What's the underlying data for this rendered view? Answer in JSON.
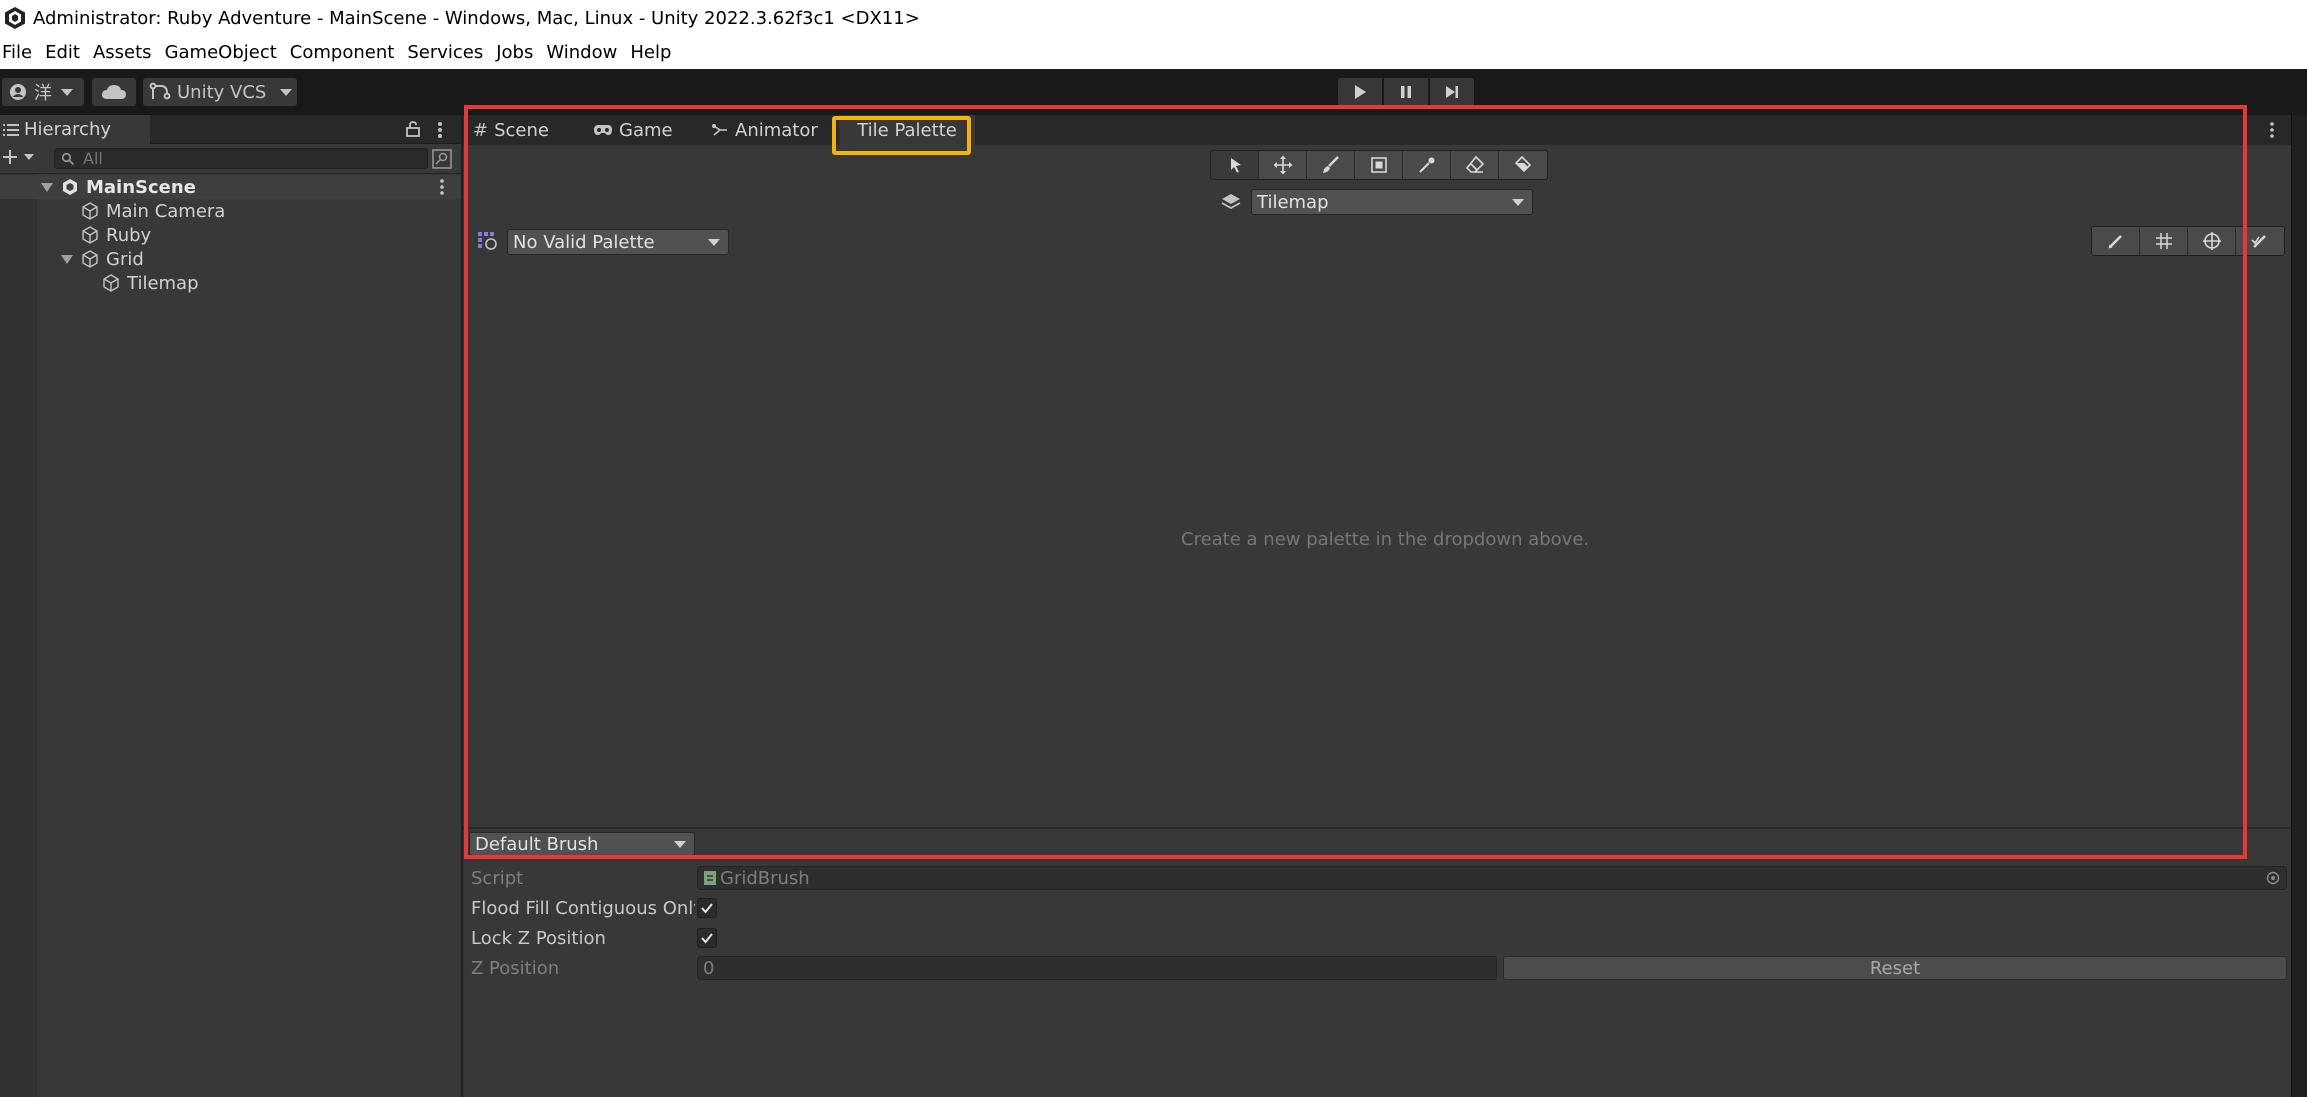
{
  "window": {
    "title": "Administrator: Ruby Adventure - MainScene - Windows, Mac, Linux - Unity 2022.3.62f3c1 <DX11>"
  },
  "menu": [
    "File",
    "Edit",
    "Assets",
    "GameObject",
    "Component",
    "Services",
    "Jobs",
    "Window",
    "Help"
  ],
  "toolbar": {
    "account_label": "洋",
    "vcs_label": "Unity VCS"
  },
  "hierarchy": {
    "tab_label": "Hierarchy",
    "search_placeholder": "All",
    "scene_name": "MainScene",
    "items": [
      {
        "label": "Main Camera"
      },
      {
        "label": "Ruby"
      },
      {
        "label": "Grid"
      },
      {
        "label": "Tilemap"
      }
    ]
  },
  "main": {
    "tabs": [
      {
        "label": "Scene",
        "icon": "grid-hash-icon"
      },
      {
        "label": "Game",
        "icon": "gamepad-icon"
      },
      {
        "label": "Animator",
        "icon": "animator-icon"
      },
      {
        "label": "Tile Palette",
        "icon": "",
        "active": true
      }
    ]
  },
  "tile_palette": {
    "target_dropdown": "Tilemap",
    "palette_dropdown": "No Valid Palette",
    "empty_message": "Create a new palette in the dropdown above.",
    "brush_dropdown": "Default Brush"
  },
  "inspector": {
    "script_label": "Script",
    "script_value": "GridBrush",
    "flood_fill_label": "Flood Fill Contiguous Only",
    "flood_fill_checked": true,
    "lock_z_label": "Lock Z Position",
    "lock_z_checked": true,
    "z_position_label": "Z Position",
    "z_position_value": "0",
    "reset_label": "Reset"
  },
  "annotations": {
    "red_box_color": "#e53935",
    "yellow_box_color": "#f4b400"
  }
}
